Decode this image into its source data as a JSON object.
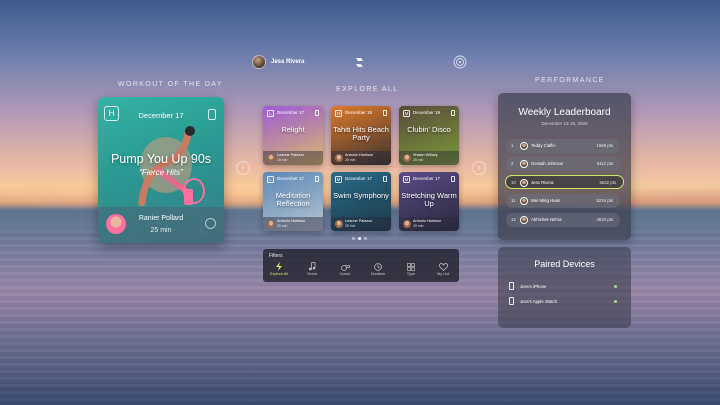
{
  "topbar": {
    "user_name": "Jess Rivera",
    "center_icon": "fitness-logo-icon",
    "right_icon": "target-icon"
  },
  "wod": {
    "section_title": "WORKOUT OF THE DAY",
    "badge": "H",
    "date": "December 17",
    "title": "Pump You Up 90s",
    "subtitle": "“Fierce Hits”",
    "instructor": "Ranier Pollard",
    "duration": "25 min",
    "accent": "#33b3a4"
  },
  "explore": {
    "section_title": "EXPLORE ALL",
    "prev_icon": "chevron-left-icon",
    "next_icon": "chevron-right-icon",
    "cards": [
      {
        "badge": "L",
        "date": "December 17",
        "title": "Relight",
        "instructor": "Leanne Palazzo",
        "duration": "25 min",
        "color_top": "#9f5ad8",
        "color_bottom": "#d8b86a"
      },
      {
        "badge": "H",
        "date": "December 18",
        "title": "Tahiti Hits Beach Party",
        "instructor": "Antonio Harrison",
        "duration": "25 min",
        "color_top": "#e07a2a",
        "color_bottom": "#3a3230"
      },
      {
        "badge": "M",
        "date": "December 19",
        "title": "Clubin' Disco",
        "instructor": "Shawn Willacy",
        "duration": "25 min",
        "color_top": "#5a4a3a",
        "color_bottom": "#7a9a3a"
      },
      {
        "badge": "L",
        "date": "December 17",
        "title": "Meditation Reflection",
        "instructor": "Antonio Harrison",
        "duration": "25 min",
        "color_top": "#5a8ab8",
        "color_bottom": "#b8c2d0"
      },
      {
        "badge": "M",
        "date": "December 17",
        "title": "Swim Symphony",
        "instructor": "Leanne Palazzo",
        "duration": "25 min",
        "color_top": "#2a6a8a",
        "color_bottom": "#1a3a4a"
      },
      {
        "badge": "M",
        "date": "December 17",
        "title": "Stretching Warm Up",
        "instructor": "Antonio Harrison",
        "duration": "25 min",
        "color_top": "#5a4a8a",
        "color_bottom": "#2a2a3a"
      }
    ],
    "page_count": 3,
    "active_page": 1
  },
  "filters": {
    "label": "Filters",
    "items": [
      {
        "label": "Explore All",
        "icon": "bolt-icon",
        "active": true
      },
      {
        "label": "Genre",
        "icon": "music-note-icon",
        "active": false
      },
      {
        "label": "Coach",
        "icon": "whistle-icon",
        "active": false
      },
      {
        "label": "Duration",
        "icon": "clock-icon",
        "active": false
      },
      {
        "label": "Type",
        "icon": "grid-icon",
        "active": false
      },
      {
        "label": "My List",
        "icon": "heart-icon",
        "active": false
      }
    ]
  },
  "performance": {
    "section_title": "PERFORMANCE",
    "title": "Weekly Leaderboard",
    "range": "December 13-19, 2020",
    "rows": [
      {
        "rank": "1",
        "name": "Teddy Claflin",
        "points": "1568 pts",
        "me": false
      },
      {
        "rank": "2",
        "name": "Gessah Johnson",
        "points": "6112 pts",
        "me": false
      },
      {
        "rank": "10",
        "name": "Jess Rivera",
        "points": "5632 pts",
        "me": true
      },
      {
        "rank": "11",
        "name": "Wei Ming Huan",
        "points": "5216 pts",
        "me": false
      },
      {
        "rank": "12",
        "name": "Abhishek Nehra",
        "points": "4833 pts",
        "me": false
      }
    ],
    "highlight_color": "#cfe36a"
  },
  "paired": {
    "title": "Paired Devices",
    "devices": [
      {
        "name": "Jess's iPhone",
        "icon": "phone-icon",
        "connected": true
      },
      {
        "name": "Jess's Apple Watch",
        "icon": "watch-icon",
        "connected": true
      }
    ]
  }
}
